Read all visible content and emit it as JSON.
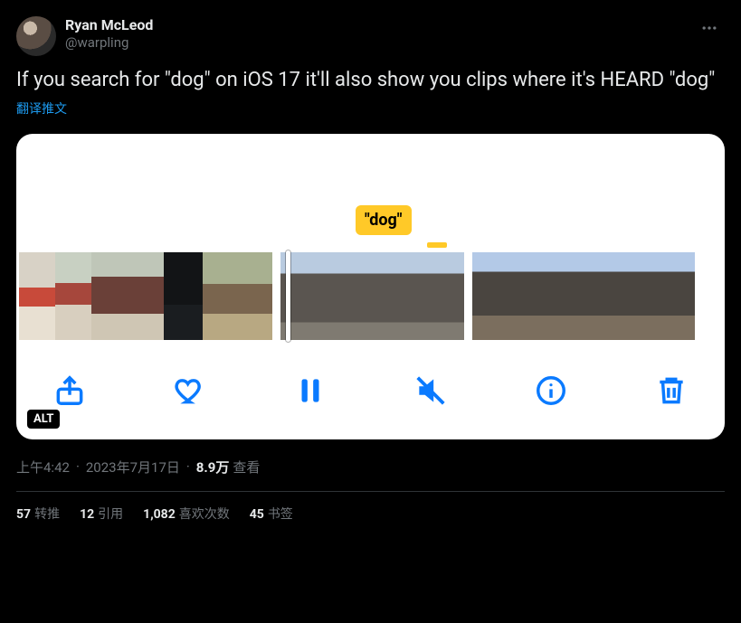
{
  "author": {
    "display_name": "Ryan McLeod",
    "handle": "@warpling"
  },
  "body": "If you search for \"dog\" on iOS 17 it'll also show you clips where it's HEARD \"dog\"",
  "translate_label": "翻译推文",
  "media": {
    "search_term": "\"dog\"",
    "alt_badge": "ALT"
  },
  "timestamp": {
    "time": "上午4:42",
    "date": "2023年7月17日",
    "views_count": "8.9万",
    "views_label": "查看"
  },
  "stats": {
    "retweets": {
      "count": "57",
      "label": "转推"
    },
    "quotes": {
      "count": "12",
      "label": "引用"
    },
    "likes": {
      "count": "1,082",
      "label": "喜欢次数"
    },
    "bookmarks": {
      "count": "45",
      "label": "书签"
    }
  }
}
